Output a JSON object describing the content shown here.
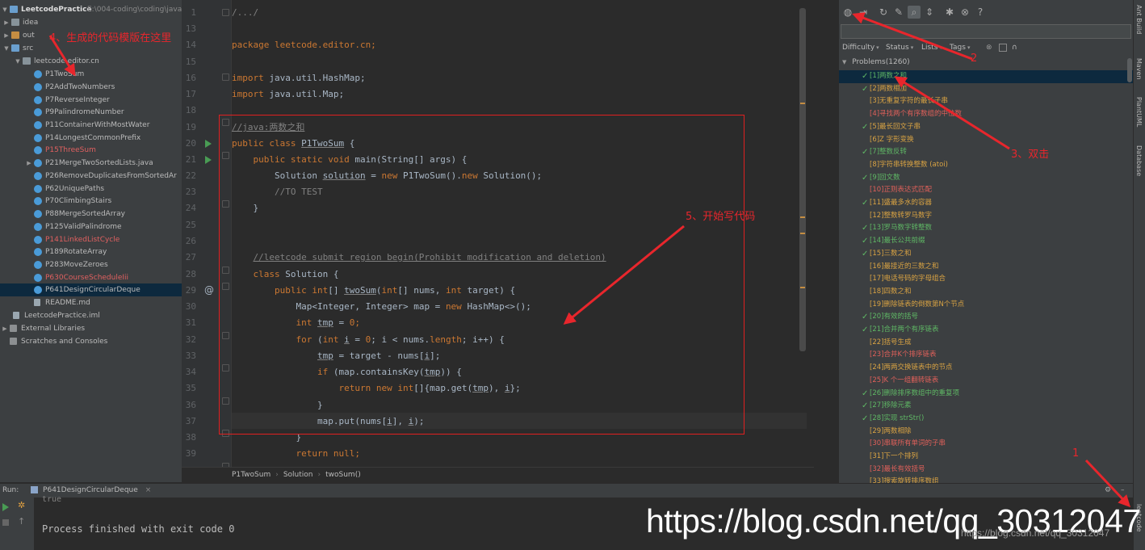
{
  "project_tree": {
    "root_label": "LeetcodePractice",
    "root_path": "E:\\004-coding\\coding\\java",
    "items": [
      {
        "label": "idea",
        "color": "normal",
        "icon": "folder-icon"
      },
      {
        "label": "out",
        "color": "normal",
        "icon": "folder-icon"
      },
      {
        "label": "src",
        "color": "normal",
        "icon": "folder-icon"
      },
      {
        "label": "leetcode.editor.cn",
        "color": "normal",
        "icon": "package-icon"
      },
      {
        "label": "P1TwoSum",
        "color": "normal",
        "icon": "class-icon"
      },
      {
        "label": "P2AddTwoNumbers",
        "color": "normal",
        "icon": "class-icon"
      },
      {
        "label": "P7ReverseInteger",
        "color": "normal",
        "icon": "class-icon"
      },
      {
        "label": "P9PalindromeNumber",
        "color": "normal",
        "icon": "class-icon"
      },
      {
        "label": "P11ContainerWithMostWater",
        "color": "normal",
        "icon": "class-icon"
      },
      {
        "label": "P14LongestCommonPrefix",
        "color": "normal",
        "icon": "class-icon"
      },
      {
        "label": "P15ThreeSum",
        "color": "red",
        "icon": "class-icon"
      },
      {
        "label": "P21MergeTwoSortedLists.java",
        "color": "normal",
        "icon": "class-icon"
      },
      {
        "label": "P26RemoveDuplicatesFromSortedAr",
        "color": "normal",
        "icon": "class-icon"
      },
      {
        "label": "P62UniquePaths",
        "color": "normal",
        "icon": "class-icon"
      },
      {
        "label": "P70ClimbingStairs",
        "color": "normal",
        "icon": "class-icon"
      },
      {
        "label": "P88MergeSortedArray",
        "color": "normal",
        "icon": "class-icon"
      },
      {
        "label": "P125ValidPalindrome",
        "color": "normal",
        "icon": "class-icon"
      },
      {
        "label": "P141LinkedListCycle",
        "color": "red",
        "icon": "class-icon"
      },
      {
        "label": "P189RotateArray",
        "color": "normal",
        "icon": "class-icon"
      },
      {
        "label": "P283MoveZeroes",
        "color": "normal",
        "icon": "class-icon"
      },
      {
        "label": "P630CourseScheduleIii",
        "color": "red",
        "icon": "class-icon"
      },
      {
        "label": "P641DesignCircularDeque",
        "color": "normal",
        "icon": "class-icon"
      },
      {
        "label": "README.md",
        "color": "normal",
        "icon": "file-icon"
      },
      {
        "label": "LeetcodePractice.iml",
        "color": "normal",
        "icon": "file-icon"
      },
      {
        "label": "External Libraries",
        "color": "normal",
        "icon": "library-icon"
      },
      {
        "label": "Scratches and Consoles",
        "color": "normal",
        "icon": "scratch-icon"
      }
    ]
  },
  "editor": {
    "line_numbers": [
      "1",
      "13",
      "14",
      "15",
      "16",
      "17",
      "18",
      "19",
      "20",
      "21",
      "22",
      "23",
      "24",
      "25",
      "26",
      "27",
      "28",
      "29",
      "30",
      "31",
      "32",
      "33",
      "34",
      "35",
      "36",
      "37",
      "38",
      "39",
      "40"
    ],
    "code": {
      "l1": "/.../",
      "l14": "package leetcode.editor.cn;",
      "l16_kw": "import",
      "l16_rest": " java.util.HashMap;",
      "l17_kw": "import",
      "l17_rest": " java.util.Map;",
      "l19": "//java:两数之和",
      "l20_kw": "public class ",
      "l20_name": "P1TwoSum",
      "l20_rest": " {",
      "l21_kw": "public static void ",
      "l21_rest": "main(String[] args) {",
      "l22_a": "Solution ",
      "l22_var": "solution",
      "l22_b": " = ",
      "l22_kw1": "new ",
      "l22_c": "P1TwoSum().",
      "l22_kw2": "new ",
      "l22_d": "Solution();",
      "l23": "//TO TEST",
      "l24": "}",
      "l27": "//leetcode submit region begin(Prohibit modification and deletion)",
      "l28_kw": "class ",
      "l28_rest": "Solution {",
      "l29_kw": "public int",
      "l29_a": "[] ",
      "l29_name": "twoSum",
      "l29_b": "(",
      "l29_kw2": "int",
      "l29_c": "[] nums, ",
      "l29_kw3": "int ",
      "l29_d": "target) {",
      "l30_a": "Map<Integer, Integer> map = ",
      "l30_kw": "new ",
      "l30_b": "HashMap<>();",
      "l31_kw": "int ",
      "l31_var": "tmp",
      "l31_b": " = ",
      "l31_num": "0",
      "l31_c": ";",
      "l32_kw": "for ",
      "l32_a": "(",
      "l32_kw2": "int ",
      "l32_var": "i",
      "l32_b": " = ",
      "l32_num": "0",
      "l32_c": "; i < nums.",
      "l32_d": "length",
      "l32_e": "; i++) {",
      "l33_var": "tmp",
      "l33_a": " = target - nums[",
      "l33_i": "i",
      "l33_b": "];",
      "l34_kw": "if ",
      "l34_a": "(map.containsKey(",
      "l34_var": "tmp",
      "l34_b": ")) {",
      "l35_kw": "return new int",
      "l35_a": "[]{map.get(",
      "l35_var": "tmp",
      "l35_b": "), ",
      "l35_i": "i",
      "l35_c": "};",
      "l36": "}",
      "l37_a": "map.put(nums[",
      "l37_i": "i",
      "l37_b": "], ",
      "l37_i2": "i",
      "l37_c": ");",
      "l38": "}",
      "l39_kw": "return null",
      "l39_a": ";",
      "l40": "}"
    },
    "breadcrumb": [
      "P1TwoSum",
      "Solution",
      "twoSum()"
    ]
  },
  "leetcode_panel": {
    "toolbar_icons": [
      "globe-icon",
      "login-icon",
      "refresh-icon",
      "wrench-icon",
      "search-icon",
      "collapse-icon",
      "settings-icon",
      "close-icon",
      "help-icon"
    ],
    "filters": {
      "difficulty": "Difficulty",
      "status": "Status",
      "lists": "Lists",
      "tags": "Tags",
      "extra": "∩"
    },
    "root": "Problems(1260)",
    "problems": [
      {
        "text": "[1]两数之和",
        "solved": true,
        "level": "easy",
        "selected": true
      },
      {
        "text": "[2]两数相加",
        "solved": true,
        "level": "med"
      },
      {
        "text": "[3]无重复字符的最长子串",
        "solved": false,
        "level": "med"
      },
      {
        "text": "[4]寻找两个有序数组的中位数",
        "solved": false,
        "level": "hard"
      },
      {
        "text": "[5]最长回文子串",
        "solved": true,
        "level": "med"
      },
      {
        "text": "[6]Z 字形变换",
        "solved": false,
        "level": "med"
      },
      {
        "text": "[7]整数反转",
        "solved": true,
        "level": "easy"
      },
      {
        "text": "[8]字符串转换整数 (atoi)",
        "solved": false,
        "level": "med"
      },
      {
        "text": "[9]回文数",
        "solved": true,
        "level": "easy"
      },
      {
        "text": "[10]正则表达式匹配",
        "solved": false,
        "level": "hard"
      },
      {
        "text": "[11]盛最多水的容器",
        "solved": true,
        "level": "med"
      },
      {
        "text": "[12]整数转罗马数字",
        "solved": false,
        "level": "med"
      },
      {
        "text": "[13]罗马数字转整数",
        "solved": true,
        "level": "easy"
      },
      {
        "text": "[14]最长公共前缀",
        "solved": true,
        "level": "easy"
      },
      {
        "text": "[15]三数之和",
        "solved": true,
        "level": "med"
      },
      {
        "text": "[16]最接近的三数之和",
        "solved": false,
        "level": "med"
      },
      {
        "text": "[17]电话号码的字母组合",
        "solved": false,
        "level": "med"
      },
      {
        "text": "[18]四数之和",
        "solved": false,
        "level": "med"
      },
      {
        "text": "[19]删除链表的倒数第N个节点",
        "solved": false,
        "level": "med"
      },
      {
        "text": "[20]有效的括号",
        "solved": true,
        "level": "easy"
      },
      {
        "text": "[21]合并两个有序链表",
        "solved": true,
        "level": "easy"
      },
      {
        "text": "[22]括号生成",
        "solved": false,
        "level": "med"
      },
      {
        "text": "[23]合并K个排序链表",
        "solved": false,
        "level": "hard"
      },
      {
        "text": "[24]两两交换链表中的节点",
        "solved": false,
        "level": "med"
      },
      {
        "text": "[25]K 个一组翻转链表",
        "solved": false,
        "level": "hard"
      },
      {
        "text": "[26]删除排序数组中的重复项",
        "solved": true,
        "level": "easy"
      },
      {
        "text": "[27]移除元素",
        "solved": true,
        "level": "easy"
      },
      {
        "text": "[28]实现 strStr()",
        "solved": true,
        "level": "easy"
      },
      {
        "text": "[29]两数相除",
        "solved": false,
        "level": "med"
      },
      {
        "text": "[30]串联所有单词的子串",
        "solved": false,
        "level": "hard"
      },
      {
        "text": "[31]下一个排列",
        "solved": false,
        "level": "med"
      },
      {
        "text": "[32]最长有效括号",
        "solved": false,
        "level": "hard"
      },
      {
        "text": "[33]搜索旋转排序数组",
        "solved": false,
        "level": "med"
      }
    ]
  },
  "right_strip": {
    "tabs": [
      "Ant Build",
      "Maven",
      "PlantUML",
      "Database",
      "leetcode"
    ]
  },
  "run_panel": {
    "label": "Run:",
    "tab": "P641DesignCircularDeque",
    "output_partial": "true",
    "output": "Process finished with exit code 0"
  },
  "annotations": {
    "a1": "1",
    "a2": "2",
    "a3": "3、双击",
    "a4": "4、生成的代码模版在这里",
    "a5": "5、开始写代码"
  },
  "watermark": {
    "big": "https://blog.csdn.net/qq_30312047",
    "small": "https://blog.csdn.net/qq_30312047"
  },
  "colors": {
    "easy": "#5fb865",
    "medium": "#d9a343",
    "hard": "#e0605a",
    "annotation": "#e8262c",
    "selection": "#0d293e"
  }
}
